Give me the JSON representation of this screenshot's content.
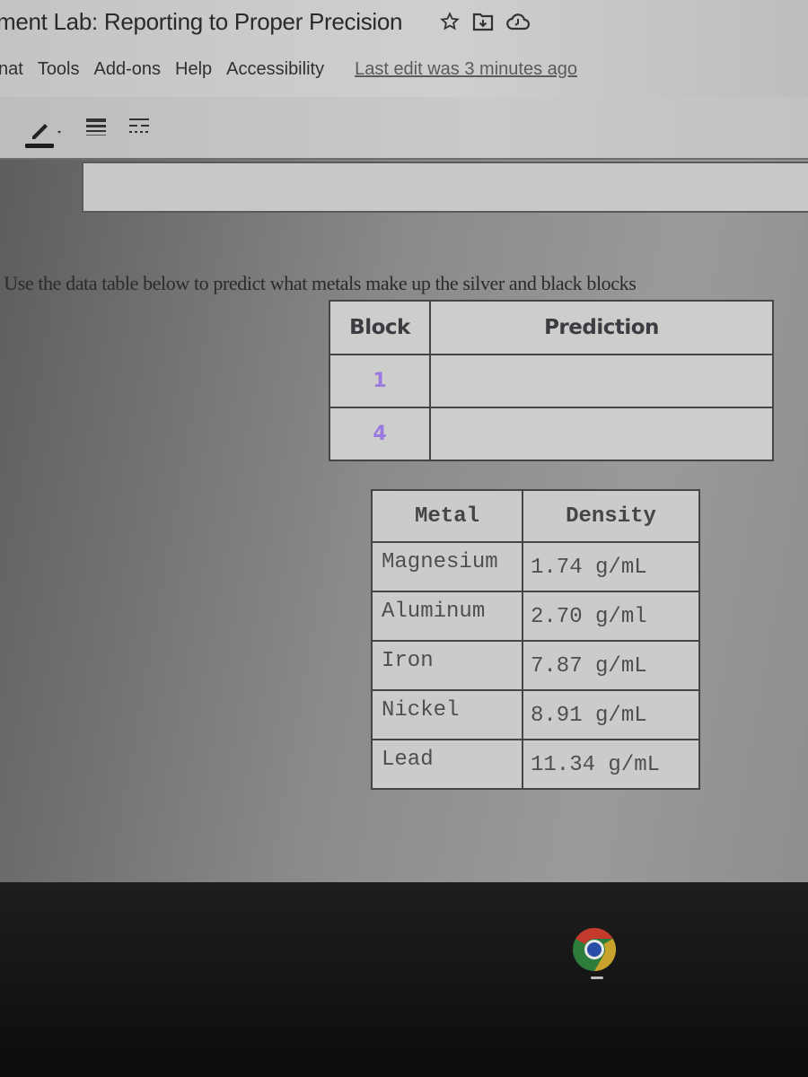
{
  "document": {
    "title": "ment Lab: Reporting to Proper Precision",
    "title_icons": [
      "star-icon",
      "move-to-folder-icon",
      "cloud-saved-icon"
    ]
  },
  "menu": {
    "items": [
      {
        "label": "nat"
      },
      {
        "label": "Tools"
      },
      {
        "label": "Add-ons"
      },
      {
        "label": "Help"
      },
      {
        "label": "Accessibility"
      }
    ],
    "last_edit": "Last edit was 3 minutes ago"
  },
  "toolbar": {
    "buttons": [
      "pen-color-icon",
      "border-style-icon",
      "border-dash-icon"
    ]
  },
  "content": {
    "instruction": ". Use the data table below to predict what metals make up the silver and black blocks",
    "prediction_table": {
      "headers": [
        "Block",
        "Prediction"
      ],
      "rows": [
        {
          "block": "1",
          "prediction": ""
        },
        {
          "block": "4",
          "prediction": ""
        }
      ],
      "block_color": "#9c79e0"
    },
    "density_table": {
      "headers": [
        "Metal",
        "Density"
      ],
      "rows": [
        {
          "metal": "Magnesium",
          "density": "1.74 g/mL"
        },
        {
          "metal": "Aluminum",
          "density": "2.70 g/ml"
        },
        {
          "metal": "Iron",
          "density": "7.87 g/mL"
        },
        {
          "metal": "Nickel",
          "density": "8.91 g/mL"
        },
        {
          "metal": "Lead",
          "density": "11.34 g/mL"
        }
      ]
    }
  },
  "shelf": {
    "apps": [
      {
        "name": "Google Chrome",
        "icon": "chrome-icon"
      }
    ],
    "colors": {
      "red": "#c63a2e",
      "yellow": "#c9a22b",
      "green": "#2f7d3a",
      "blue": "#2a4ea8"
    }
  }
}
